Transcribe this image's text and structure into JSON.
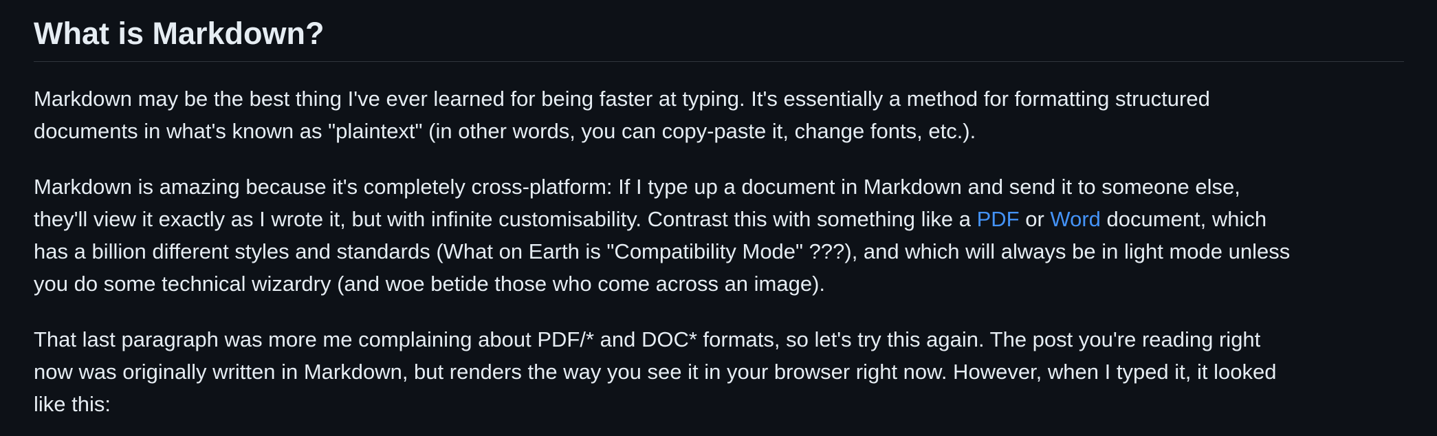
{
  "article": {
    "heading": "What is Markdown?",
    "paragraph1": {
      "line1": "Markdown may be the best thing I've ever learned for being faster at typing. It's essentially a method for formatting structured",
      "line2": "documents in what's known as \"plaintext\" (in other words, you can copy-paste it, change fonts, etc.)."
    },
    "paragraph2": {
      "line1": "Markdown is amazing because it's completely cross-platform: If I type up a document in Markdown and send it to someone else,",
      "line2_before_pdf": "they'll view it exactly as I wrote it, but with infinite customisability. Contrast this with something like a ",
      "pdf_link": "PDF",
      "between_links": " or ",
      "word_link": "Word",
      "line2_after_word": " document, which",
      "line3": "has a billion different styles and standards (What on Earth is \"Compatibility Mode\" ???), and which will always be in light mode unless",
      "line4": "you do some technical wizardry (and woe betide those who come across an image)."
    },
    "paragraph3": {
      "line1": "That last paragraph was more me complaining about PDF/* and DOC* formats, so let's try this again. The post you're reading right",
      "line2": "now was originally written in Markdown, but renders the way you see it in your browser right now. However, when I typed it, it looked",
      "line3": "like this:"
    }
  },
  "colors": {
    "background": "#0d1117",
    "text": "#e6edf3",
    "link": "#4493f8",
    "divider": "#30363d"
  }
}
